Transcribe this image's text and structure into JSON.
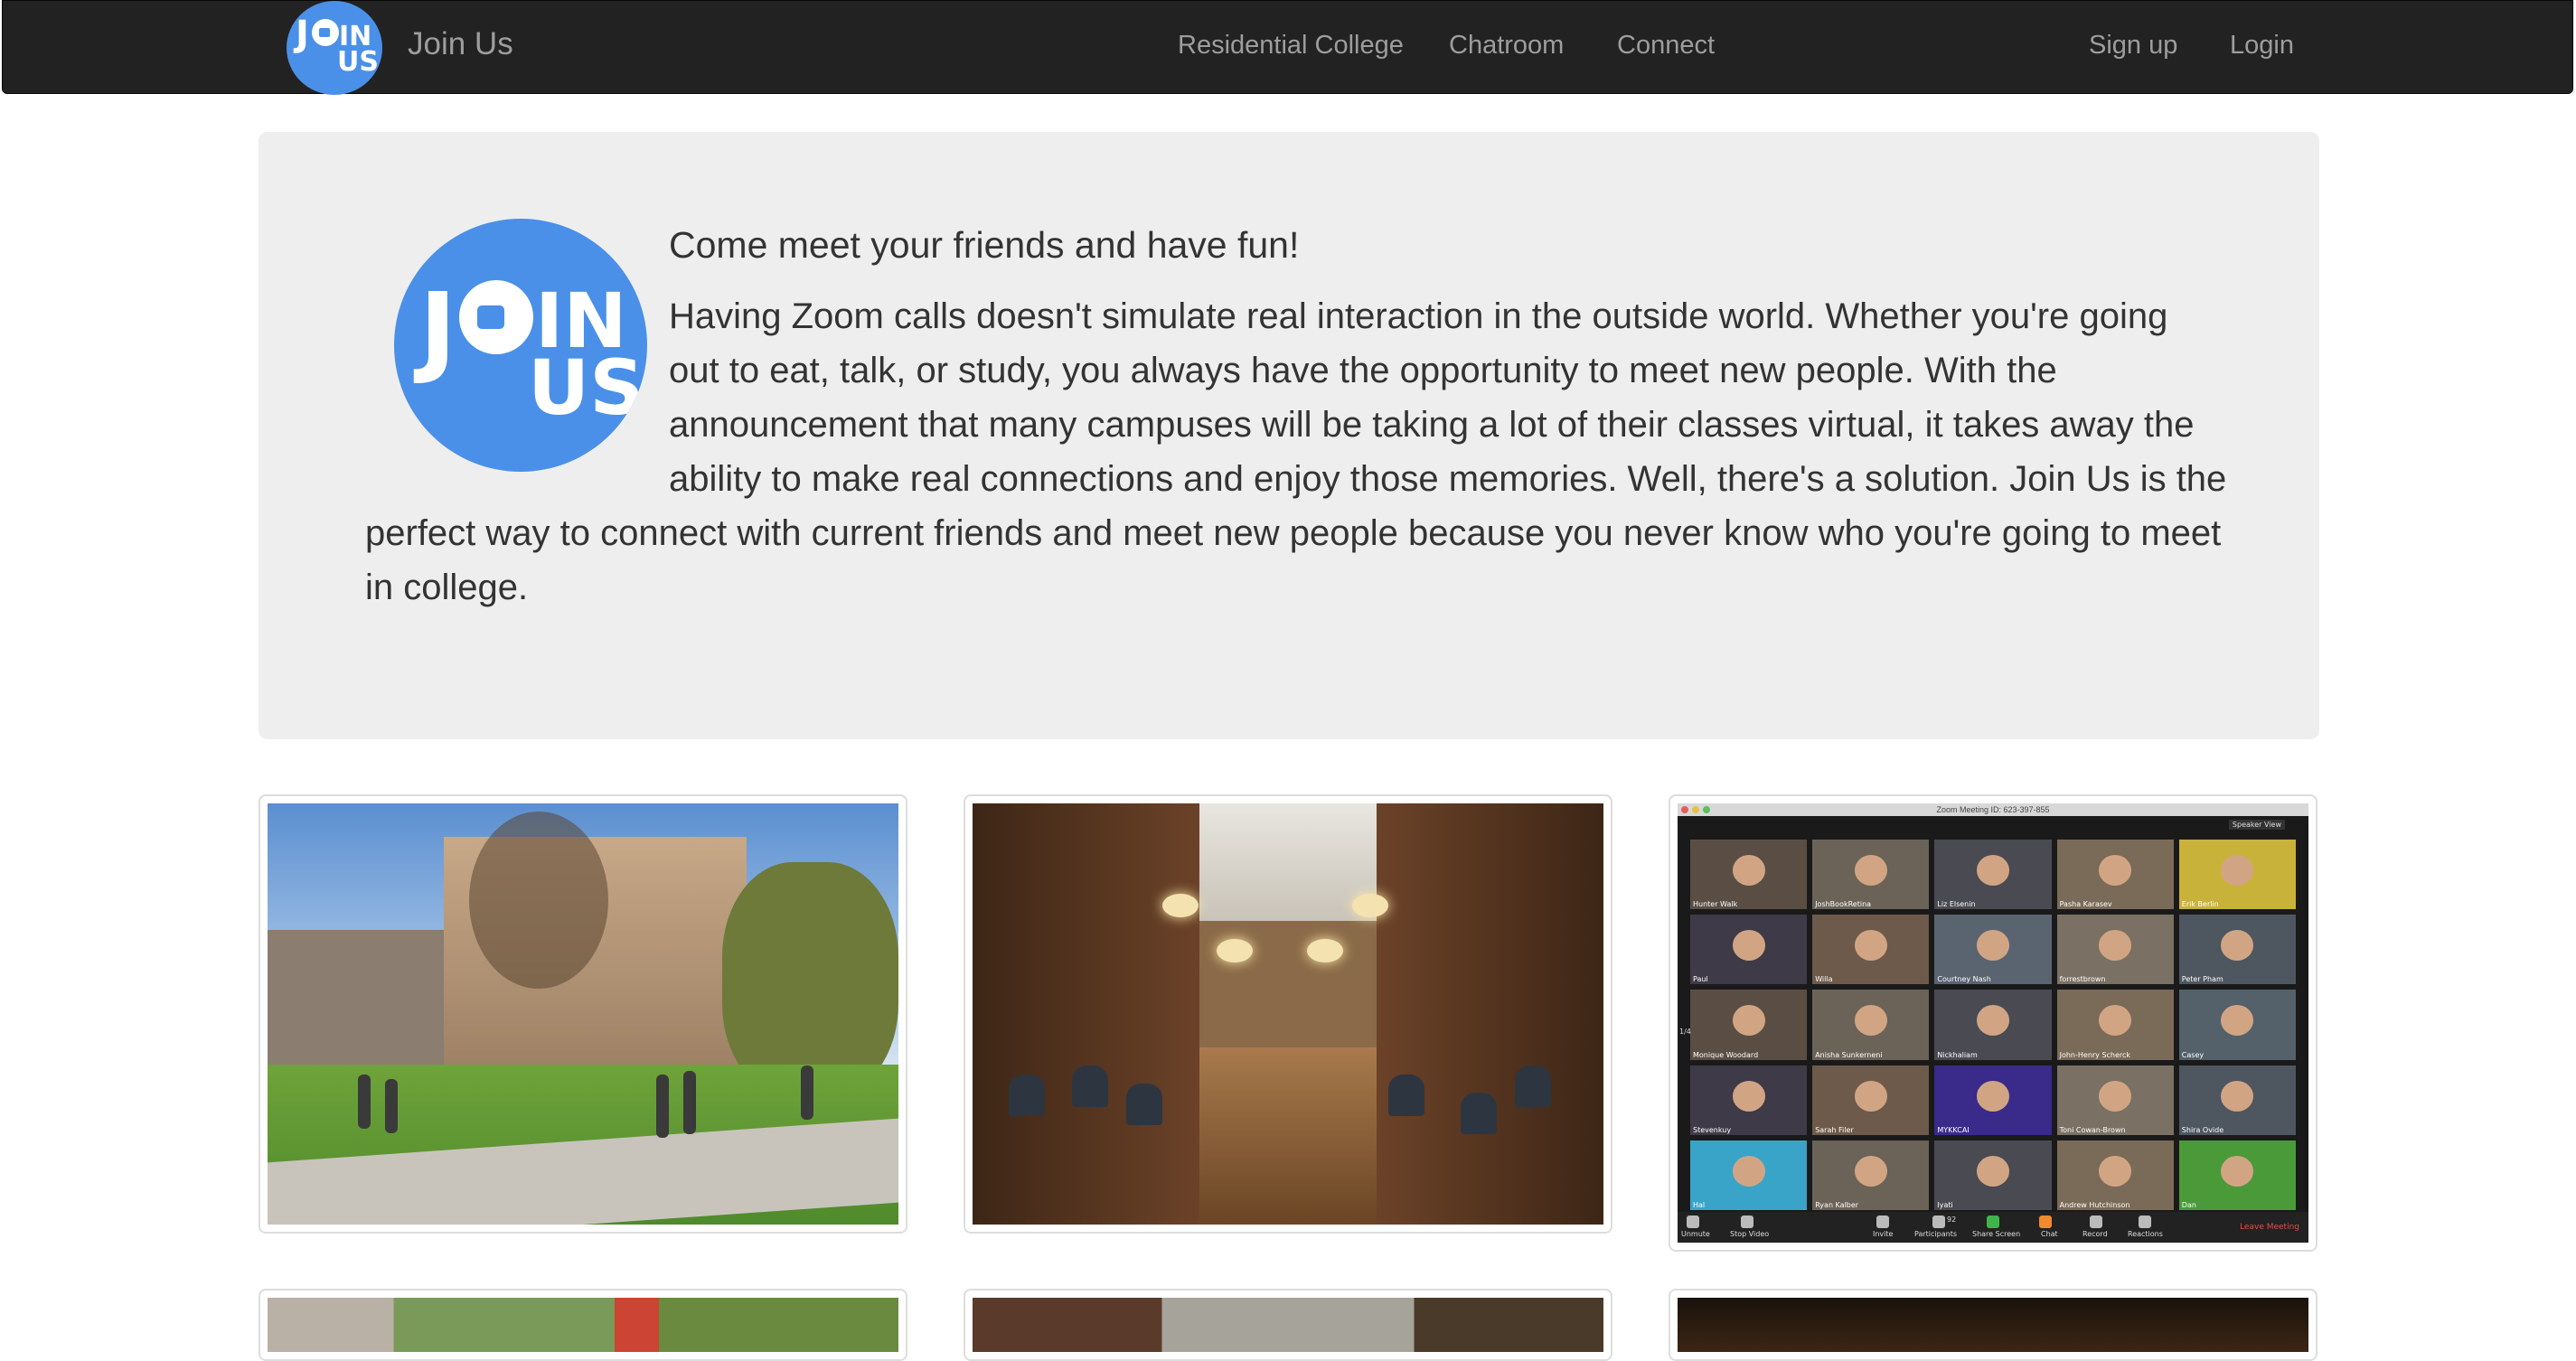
{
  "navbar": {
    "brand": "Join Us",
    "logo_text": {
      "j": "J",
      "in": "IN",
      "us": "US"
    },
    "links": [
      "Residential College",
      "Chatroom",
      "Connect"
    ],
    "right_links": [
      "Sign up",
      "Login"
    ]
  },
  "hero": {
    "heading": "Come meet your friends and have fun!",
    "body": "Having Zoom calls doesn't simulate real interaction in the outside world. Whether you're going out to eat, talk, or study, you always have the opportunity to meet new people. With the announcement that many campuses will be taking a lot of their classes virtual, it takes away the ability to make real connections and enjoy those memories. Well, there's a solution. Join Us is the perfect way to connect with current friends and meet new people because you never know who you're going to meet in college."
  },
  "gallery": {
    "images": [
      "campus-photo",
      "dining-hall-photo",
      "zoom-meeting-screenshot"
    ],
    "zoom": {
      "title": "Zoom Meeting ID: 623-397-855",
      "view_button": "Speaker View",
      "participants": [
        "Hunter Walk",
        "JoshBookRetina",
        "Liz Elsenin",
        "Pasha Karasev",
        "Erik Berlin",
        "Paul",
        "Willa",
        "Courtney Nash",
        "forrestbrown",
        "Peter Pham",
        "Monique Woodard",
        "Anisha Sunkerneni",
        "Nickhaliam",
        "John-Henry Scherck",
        "Casey",
        "Stevenkuy",
        "Sarah Filer",
        "MYKKCAI",
        "Toni Cowan-Brown",
        "Shira Ovide",
        "Hal",
        "Ryan Kalber",
        "Iyati",
        "Andrew Hutchinson",
        "Dan"
      ],
      "toolbar": [
        "Unmute",
        "Stop Video",
        "Invite",
        "Participants",
        "Share Screen",
        "Chat",
        "Record",
        "Reactions"
      ],
      "participants_count": "92",
      "leave": "Leave Meeting",
      "page_indicator": "1/4"
    }
  },
  "colors": {
    "navbar_bg": "#222222",
    "nav_text": "#9d9d9d",
    "jumbotron_bg": "#eeeeee",
    "logo_blue": "#4a90e8",
    "leave_red": "#e64c4c"
  }
}
